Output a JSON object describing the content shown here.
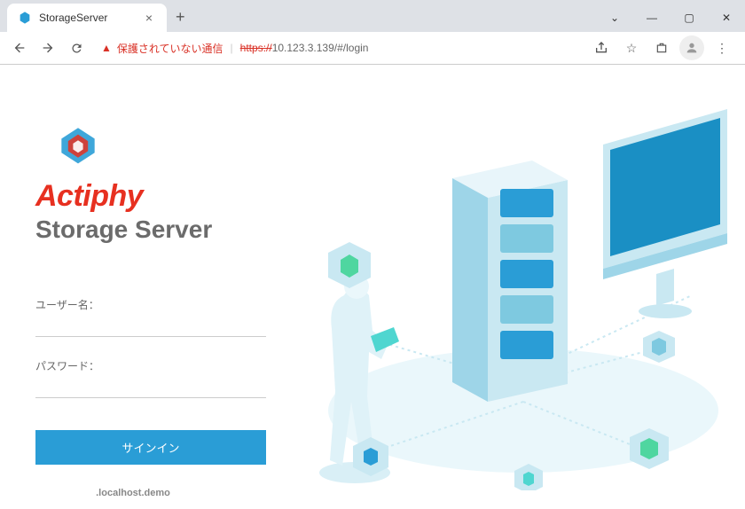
{
  "browser": {
    "tab_title": "StorageServer",
    "warning_text": "保護されていない通信",
    "url_protocol": "https://",
    "url_host": "10.123.3.139/#/login"
  },
  "page": {
    "brand_name": "Actiphy",
    "product_name": "Storage Server",
    "username_label": "ユーザー名：",
    "password_label": "パスワード：",
    "signin_label": "サインイン",
    "footer_text": ".localhost.demo"
  }
}
